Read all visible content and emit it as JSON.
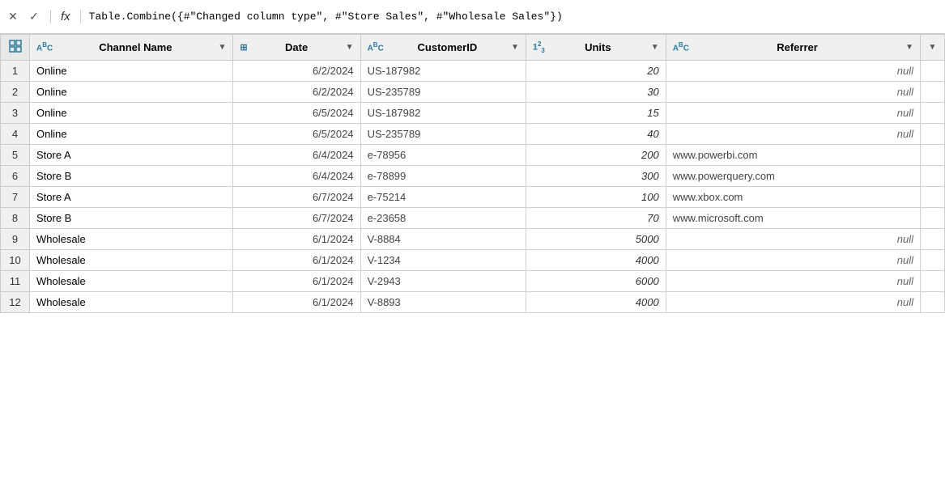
{
  "formulaBar": {
    "cancelLabel": "✕",
    "confirmLabel": "✓",
    "fxLabel": "fx",
    "formula": "Table.Combine({#\"Changed column type\", #\"Store Sales\", #\"Wholesale Sales\"})"
  },
  "table": {
    "columns": [
      {
        "id": "channel_name",
        "label": "Channel Name",
        "typeIcon": "ABC",
        "typeDisplay": "ABC"
      },
      {
        "id": "date",
        "label": "Date",
        "typeIcon": "⊞",
        "typeDisplay": "⊞"
      },
      {
        "id": "customer_id",
        "label": "CustomerID",
        "typeIcon": "ABC",
        "typeDisplay": "ABC"
      },
      {
        "id": "units",
        "label": "Units",
        "typeIcon": "123",
        "typeDisplay": "123"
      },
      {
        "id": "referrer",
        "label": "Referrer",
        "typeIcon": "ABC",
        "typeDisplay": "ABC"
      }
    ],
    "rows": [
      {
        "num": 1,
        "channel": "Online",
        "date": "6/2/2024",
        "customerId": "US-187982",
        "units": "20",
        "referrer": "null",
        "referrerIsNull": true
      },
      {
        "num": 2,
        "channel": "Online",
        "date": "6/2/2024",
        "customerId": "US-235789",
        "units": "30",
        "referrer": "null",
        "referrerIsNull": true
      },
      {
        "num": 3,
        "channel": "Online",
        "date": "6/5/2024",
        "customerId": "US-187982",
        "units": "15",
        "referrer": "null",
        "referrerIsNull": true
      },
      {
        "num": 4,
        "channel": "Online",
        "date": "6/5/2024",
        "customerId": "US-235789",
        "units": "40",
        "referrer": "null",
        "referrerIsNull": true
      },
      {
        "num": 5,
        "channel": "Store A",
        "date": "6/4/2024",
        "customerId": "e-78956",
        "units": "200",
        "referrer": "www.powerbi.com",
        "referrerIsNull": false
      },
      {
        "num": 6,
        "channel": "Store B",
        "date": "6/4/2024",
        "customerId": "e-78899",
        "units": "300",
        "referrer": "www.powerquery.com",
        "referrerIsNull": false
      },
      {
        "num": 7,
        "channel": "Store A",
        "date": "6/7/2024",
        "customerId": "e-75214",
        "units": "100",
        "referrer": "www.xbox.com",
        "referrerIsNull": false
      },
      {
        "num": 8,
        "channel": "Store B",
        "date": "6/7/2024",
        "customerId": "e-23658",
        "units": "70",
        "referrer": "www.microsoft.com",
        "referrerIsNull": false
      },
      {
        "num": 9,
        "channel": "Wholesale",
        "date": "6/1/2024",
        "customerId": "V-8884",
        "units": "5000",
        "referrer": "null",
        "referrerIsNull": true
      },
      {
        "num": 10,
        "channel": "Wholesale",
        "date": "6/1/2024",
        "customerId": "V-1234",
        "units": "4000",
        "referrer": "null",
        "referrerIsNull": true
      },
      {
        "num": 11,
        "channel": "Wholesale",
        "date": "6/1/2024",
        "customerId": "V-2943",
        "units": "6000",
        "referrer": "null",
        "referrerIsNull": true
      },
      {
        "num": 12,
        "channel": "Wholesale",
        "date": "6/1/2024",
        "customerId": "V-8893",
        "units": "4000",
        "referrer": "null",
        "referrerIsNull": true
      }
    ]
  }
}
